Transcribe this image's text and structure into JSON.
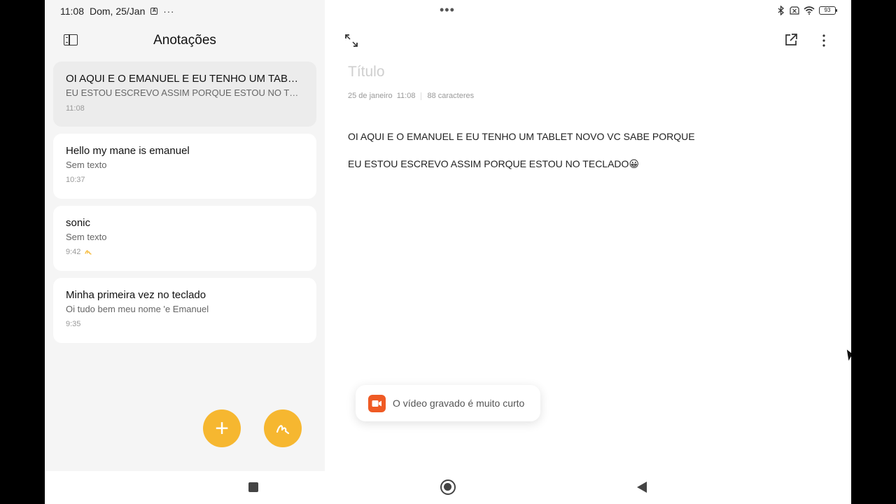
{
  "status_bar": {
    "time": "11:08",
    "date": "Dom, 25/Jan",
    "more_indicator": "···",
    "battery": "93"
  },
  "sidebar": {
    "title": "Anotações",
    "notes": [
      {
        "title": "OI  AQUI E O EMANUEL E EU TENHO UM TABLET  NOVO VC SABE PORQUE",
        "preview": "EU ESTOU  ESCREVO ASSIM PORQUE  ESTOU NO TECLADO😀",
        "time": "11:08",
        "selected": true
      },
      {
        "title": "Hello  my mane is emanuel",
        "preview": "Sem texto",
        "time": "10:37"
      },
      {
        "title": "sonic",
        "preview": "Sem texto",
        "time": "9:42",
        "has_drawing": true
      },
      {
        "title": "Minha primeira vez no teclado",
        "preview": "Oi tudo bem meu nome 'e  Emanuel",
        "time": "9:35"
      }
    ]
  },
  "editor": {
    "title_placeholder": "Título",
    "date": "25 de janeiro",
    "time": "11:08",
    "char_count": "88 caracteres",
    "body_lines": [
      "OI  AQUI E O EMANUEL E EU TENHO UM TABLET  NOVO VC SABE PORQUE",
      "EU ESTOU  ESCREVO ASSIM PORQUE  ESTOU NO TECLADO😀"
    ]
  },
  "toast": {
    "message": "O vídeo gravado é muito curto"
  },
  "icons": {
    "sidebar_toggle": "sidebar-icon",
    "fab_add": "plus-icon",
    "fab_draw": "scribble-icon",
    "expand": "expand-icon",
    "share": "share-icon",
    "more": "more-vertical-icon",
    "toast": "video-record-icon"
  },
  "colors": {
    "accent": "#f6b730",
    "toast_icon": "#ef5a24",
    "selected_card": "#ececec",
    "sidebar_bg": "#f5f5f5"
  }
}
